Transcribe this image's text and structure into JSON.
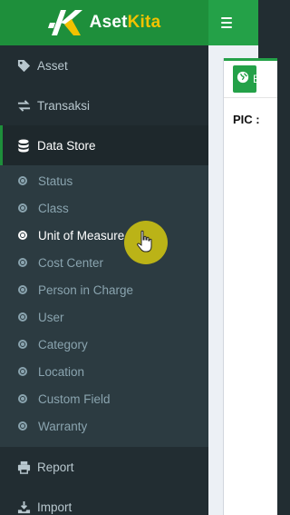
{
  "brand": {
    "name_part1": "Aset",
    "name_part2": "Kita"
  },
  "sidebar": {
    "items_top": [
      {
        "label": "Asset",
        "icon": "tag-icon"
      },
      {
        "label": "Transaksi",
        "icon": "exchange-icon"
      },
      {
        "label": "Data Store",
        "icon": "database-icon"
      }
    ],
    "submenu": [
      {
        "label": "Status"
      },
      {
        "label": "Class"
      },
      {
        "label": "Unit of Measure"
      },
      {
        "label": "Cost Center"
      },
      {
        "label": "Person in Charge"
      },
      {
        "label": "User"
      },
      {
        "label": "Category"
      },
      {
        "label": "Location"
      },
      {
        "label": "Custom Field"
      },
      {
        "label": "Warranty"
      }
    ],
    "items_bottom": [
      {
        "label": "Report",
        "icon": "print-icon"
      },
      {
        "label": "Import",
        "icon": "import-icon"
      }
    ]
  },
  "content": {
    "pic_label": "PIC :",
    "panel_title_fragment": "E"
  },
  "colors": {
    "brand_green": "#1e8f3b",
    "topbar_green": "#24a148",
    "sidebar_bg": "#222d32",
    "submenu_bg": "#2c3b41",
    "cursor_highlight": "#c8be14"
  }
}
